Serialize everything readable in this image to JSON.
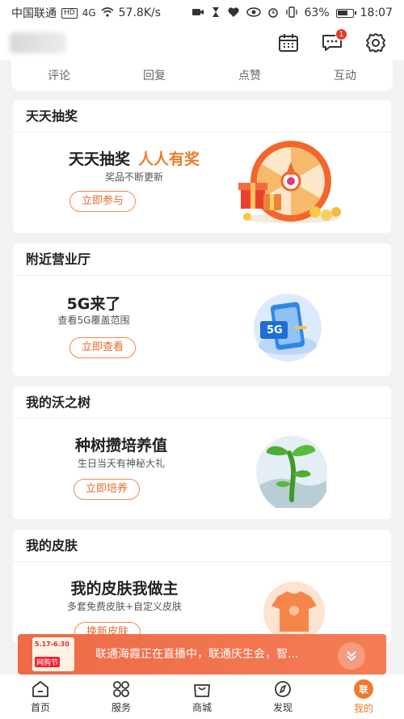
{
  "status_bar": {
    "carrier": "中国联通",
    "hd": "HD",
    "signal": "4G",
    "speed": "57.8K/s",
    "battery": "63%",
    "time": "18:07"
  },
  "header": {
    "icons": [
      "calendar-icon",
      "message-icon",
      "settings-icon"
    ],
    "message_badge": "1"
  },
  "tabs": [
    "评论",
    "回复",
    "点赞",
    "互动"
  ],
  "cards": {
    "lottery": {
      "section_title": "天天抽奖",
      "title": "天天抽奖",
      "title_highlight": "人人有奖",
      "subtitle": "奖品不断更新",
      "button": "立即参与"
    },
    "hall": {
      "section_title": "附近营业厅",
      "title": "5G来了",
      "subtitle": "查看5G覆盖范围",
      "button": "立即查看",
      "badge_text": "5G"
    },
    "tree": {
      "section_title": "我的沃之树",
      "title": "种树攒培养值",
      "subtitle": "生日当天有神秘大礼",
      "button": "立即培养"
    },
    "skin": {
      "section_title": "我的皮肤",
      "title": "我的皮肤我做主",
      "subtitle": "多套免费皮肤+自定义皮肤",
      "button": "换新皮肤"
    }
  },
  "live_banner": {
    "thumb_top": "5.17-6.30",
    "thumb_label": "网购节",
    "text": "联通海霞正在直播中，联通庆生会，智..."
  },
  "bottom_nav": [
    {
      "label": "首页",
      "icon": "home-icon"
    },
    {
      "label": "服务",
      "icon": "services-icon"
    },
    {
      "label": "商城",
      "icon": "shop-icon"
    },
    {
      "label": "发现",
      "icon": "compass-icon"
    },
    {
      "label": "我的",
      "icon": "profile-icon",
      "active_glyph": "联"
    }
  ],
  "colors": {
    "accent": "#f07a2a",
    "badge": "#e8382b",
    "banner": "#ee6a48"
  }
}
